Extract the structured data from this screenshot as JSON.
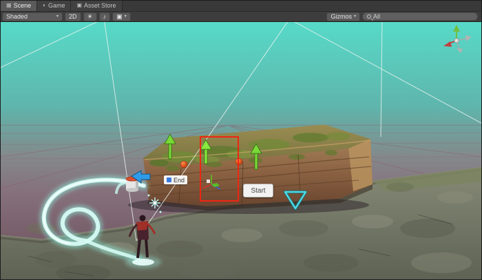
{
  "panel": {
    "tabs": [
      {
        "label": "Scene",
        "active": true
      },
      {
        "label": "Game",
        "active": false
      },
      {
        "label": "Asset Store",
        "active": false
      }
    ]
  },
  "toolbar": {
    "shading_mode": "Shaded",
    "mode_2d": "2D",
    "gizmos": "Gizmos",
    "search_value": "All"
  },
  "icons": {
    "scene": "▦",
    "game": "◐",
    "asset_store": "▣",
    "lighting": "☀",
    "audio": "♪",
    "effects": "▣",
    "caret": "▾"
  },
  "scene": {
    "start_label": "Start",
    "end_label": "End",
    "colors": {
      "selection_red": "#ef2512",
      "gizmo_green": "#79d936",
      "gizmo_orange": "#e0571e",
      "gizmo_blue": "#2f9be8",
      "trail_cyan": "#c9f7ef",
      "sky_top": "#55d8c6",
      "ground_purple": "#7e5a64"
    }
  }
}
